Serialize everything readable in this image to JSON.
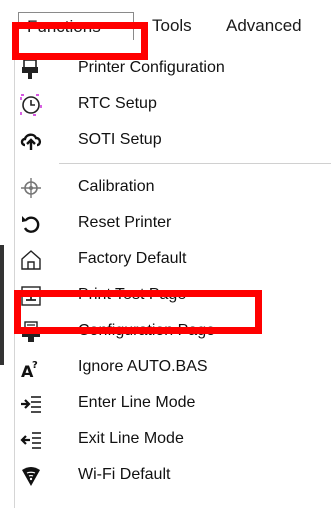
{
  "menubar": {
    "tabs": [
      {
        "label": "Functions"
      },
      {
        "label": "Tools"
      },
      {
        "label": "Advanced"
      }
    ]
  },
  "menu": {
    "items": [
      {
        "label": "Printer Configuration",
        "icon": "printer-config-icon"
      },
      {
        "label": "RTC Setup",
        "icon": "clock-icon"
      },
      {
        "label": "SOTI Setup",
        "icon": "cloud-upload-icon"
      },
      {
        "label": "Calibration",
        "icon": "crosshair-icon"
      },
      {
        "label": "Reset Printer",
        "icon": "reset-icon"
      },
      {
        "label": "Factory Default",
        "icon": "home-icon"
      },
      {
        "label": "Print Test Page",
        "icon": "print-test-icon"
      },
      {
        "label": "Configuration Page",
        "icon": "config-page-icon"
      },
      {
        "label": "Ignore AUTO.BAS",
        "icon": "ignore-autobas-icon"
      },
      {
        "label": "Enter Line Mode",
        "icon": "enter-line-mode-icon"
      },
      {
        "label": "Exit Line Mode",
        "icon": "exit-line-mode-icon"
      },
      {
        "label": "Wi-Fi Default",
        "icon": "wifi-shield-icon"
      }
    ]
  },
  "colors": {
    "highlight": "#ff0000",
    "clock": "#c81fd6"
  }
}
